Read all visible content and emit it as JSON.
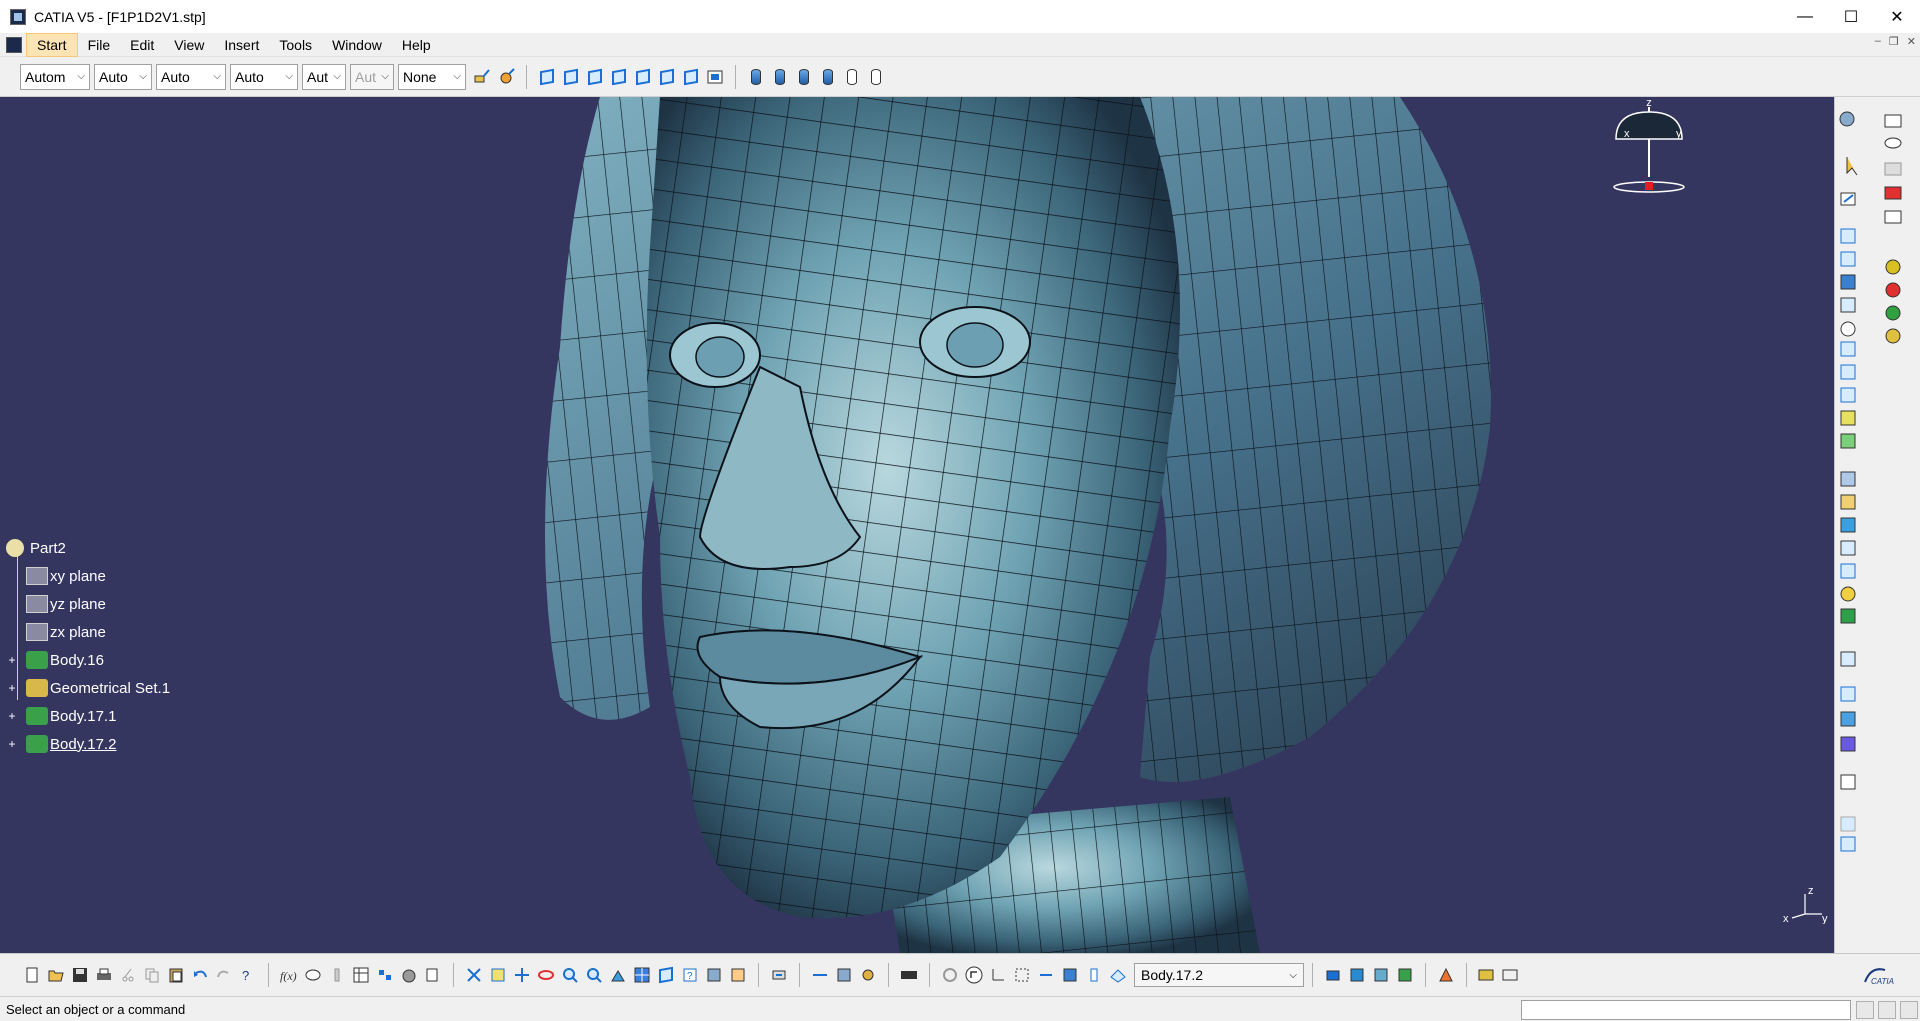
{
  "window": {
    "title": "CATIA V5 - [F1P1D2V1.stp]",
    "minimize_label": "—",
    "maximize_label": "☐",
    "close_label": "✕"
  },
  "menu": {
    "items": [
      "Start",
      "File",
      "Edit",
      "View",
      "Insert",
      "Tools",
      "Window",
      "Help"
    ],
    "active": "Start",
    "mdi_minimize": "–",
    "mdi_restore": "❐",
    "mdi_close": "✕"
  },
  "graphic_properties": {
    "combos": [
      "Autom",
      "Auto",
      "Auto",
      "Auto",
      "Aut",
      "Aut",
      "None"
    ]
  },
  "tree": {
    "root": "Part2",
    "children": [
      "xy plane",
      "yz plane",
      "zx plane",
      "Body.16",
      "Geometrical Set.1",
      "Body.17.1",
      "Body.17.2"
    ]
  },
  "compass": {
    "x_label": "x",
    "y_label": "y",
    "z_label": "z"
  },
  "mini_axes": {
    "x": "x",
    "y": "y",
    "z": "z"
  },
  "bottom_toolbar": {
    "current_body": "Body.17.2"
  },
  "status": {
    "message": "Select an object or a command"
  },
  "colors": {
    "viewport_bg": "#353660",
    "model_tint": "#6fa3b3"
  }
}
